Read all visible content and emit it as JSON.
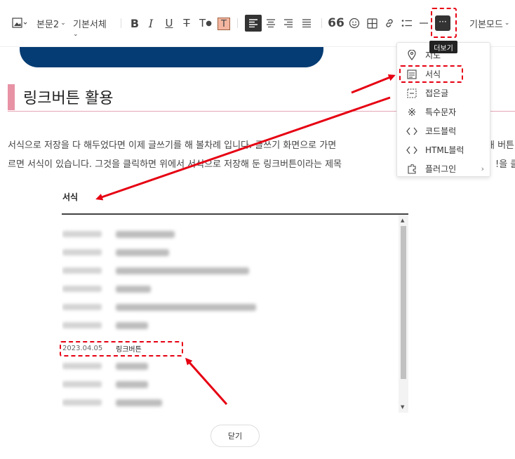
{
  "toolbar": {
    "paragraph_style": "본문2",
    "font_face": "기본서체",
    "mode": "기본모드",
    "more_tooltip": "더보기"
  },
  "more_menu": {
    "items": [
      {
        "label": "지도",
        "icon": "map-pin-icon"
      },
      {
        "label": "서식",
        "icon": "template-icon"
      },
      {
        "label": "접은글",
        "icon": "fold-icon"
      },
      {
        "label": "특수문자",
        "icon": "special-char-icon"
      },
      {
        "label": "코드블럭",
        "icon": "code-icon"
      },
      {
        "label": "HTML블럭",
        "icon": "html-icon"
      },
      {
        "label": "플러그인",
        "icon": "plugin-icon",
        "arrow": "›"
      }
    ]
  },
  "document": {
    "heading": "링크버튼 활용",
    "paragraph_line1": "서식으로 저장을 다 해두었다면 이제 글쓰기를 해 볼차례 입니다. 글쓰기 화면으로 가면 ",
    "paragraph_line1_tail": "개 버튼",
    "paragraph_line2": "르면 서식이 있습니다. 그것을 클릭하면 위에서 서식으로 저장해 둔 링크버튼이라는 제목",
    "paragraph_line2_tail": "!을 클"
  },
  "template_dialog": {
    "title": "서식",
    "highlighted_row": {
      "date": "2023.04.05",
      "name": "링크버튼"
    },
    "close_label": "닫기"
  },
  "colors": {
    "accent_red": "#e60012",
    "banner_navy": "#053c73",
    "heading_bar": "#e792a5"
  }
}
